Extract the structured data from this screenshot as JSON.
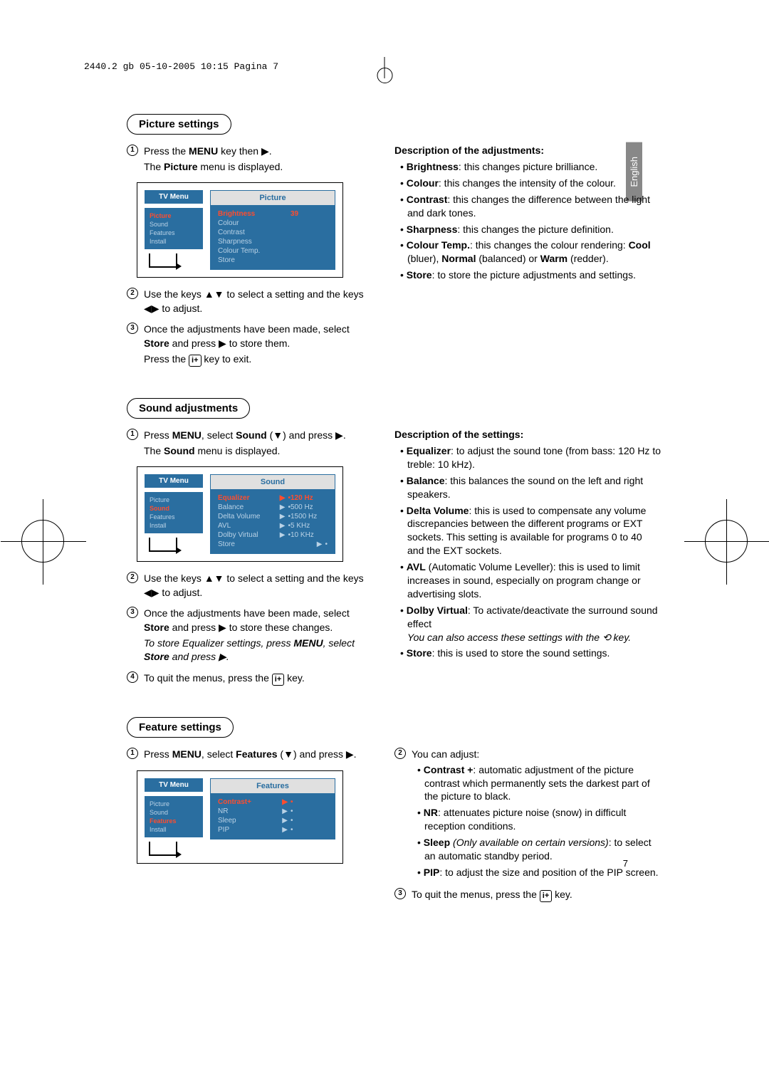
{
  "header": "2440.2 gb  05-10-2005  10:15  Pagina 7",
  "lang_tab": "English",
  "page_number": "7",
  "picture_section": {
    "heading": "Picture settings",
    "step1_a": "Press the ",
    "step1_menu": "MENU",
    "step1_b": " key then ▶.",
    "step1_c": "The ",
    "step1_picture": "Picture",
    "step1_d": " menu is displayed.",
    "menu": {
      "tv_menu": "TV Menu",
      "items": [
        "Picture",
        "Sound",
        "Features",
        "Install"
      ],
      "title": "Picture",
      "rows": [
        {
          "label": "Brightness",
          "value": "39",
          "sel": true
        },
        {
          "label": "Colour",
          "value": "",
          "dim": true
        },
        {
          "label": "Contrast",
          "value": "",
          "dim": true
        },
        {
          "label": "Sharpness",
          "value": "",
          "dim": true
        },
        {
          "label": "Colour Temp.",
          "value": "",
          "dim": true
        },
        {
          "label": "Store",
          "value": "",
          "dim": true
        }
      ]
    },
    "step2": "Use the keys ▲▼ to select a setting and the keys ◀▶ to adjust.",
    "step3_a": "Once the adjustments have been made, select ",
    "step3_store": "Store",
    "step3_b": " and press ▶ to store them.",
    "step3_c": "Press the ",
    "step3_key": "i+",
    "step3_d": " key to exit.",
    "desc_title": "Description of the adjustments:",
    "desc": {
      "brightness_k": "Brightness",
      "brightness_v": ": this changes picture brilliance.",
      "colour_k": "Colour",
      "colour_v": ": this changes the intensity of the colour.",
      "contrast_k": "Contrast",
      "contrast_v": ": this changes the difference between the light and dark tones.",
      "sharpness_k": "Sharpness",
      "sharpness_v": ": this changes the picture definition.",
      "ct_k": "Colour Temp.",
      "ct_v": ": this changes the colour rendering: ",
      "ct_cool": "Cool",
      "ct_cool_v": " (bluer), ",
      "ct_norm": "Normal",
      "ct_norm_v": " (balanced) or ",
      "ct_warm": "Warm",
      "ct_warm_v": " (redder).",
      "store_k": "Store",
      "store_v": ": to store the picture adjustments and settings."
    }
  },
  "sound_section": {
    "heading": "Sound adjustments",
    "step1_a": "Press ",
    "step1_menu": "MENU",
    "step1_b": ", select ",
    "step1_sound": "Sound",
    "step1_c": " (▼) and press ▶.",
    "step1_d": "The ",
    "step1_sound2": "Sound",
    "step1_e": " menu is displayed.",
    "menu": {
      "tv_menu": "TV Menu",
      "items": [
        "Picture",
        "Sound",
        "Features",
        "Install"
      ],
      "title": "Sound",
      "rows": [
        {
          "label": "Equalizer",
          "tri": "▶",
          "value": "120 Hz",
          "sel": true
        },
        {
          "label": "Balance",
          "tri": "▶",
          "value": "500 Hz",
          "dim": true
        },
        {
          "label": "Delta Volume",
          "tri": "▶",
          "value": "1500 Hz",
          "dim": true
        },
        {
          "label": "AVL",
          "tri": "▶",
          "value": "5 KHz",
          "dim": true
        },
        {
          "label": "Dolby Virtual",
          "tri": "▶",
          "value": "10 KHz",
          "dim": true
        },
        {
          "label": "Store",
          "tri": "▶",
          "value": "",
          "dim": true
        }
      ]
    },
    "step2": "Use the keys ▲▼ to select a setting and the keys ◀▶ to adjust.",
    "step3_a": "Once the adjustments have been made, select ",
    "step3_store": "Store",
    "step3_b": " and press ▶ to store these changes.",
    "step3_note_a": "To store Equalizer settings, press ",
    "step3_note_menu": "MENU",
    "step3_note_b": ", select ",
    "step3_note_store": "Store",
    "step3_note_c": " and press ▶.",
    "step4_a": "To quit the menus, press the ",
    "step4_key": "i+",
    "step4_b": " key.",
    "desc_title": "Description of the settings:",
    "desc": {
      "eq_k": "Equalizer",
      "eq_v": ": to adjust the sound tone (from bass: 120 Hz to treble: 10 kHz).",
      "bal_k": "Balance",
      "bal_v": ": this balances the sound on the left and right speakers.",
      "dv_k": "Delta Volume",
      "dv_v": ": this is used to compensate any volume discrepancies between the different programs or EXT sockets. This setting is available for programs 0 to 40 and the EXT sockets.",
      "avl_k": "AVL",
      "avl_v": " (Automatic Volume Leveller): this is used to limit increases in sound, especially on program change or advertising slots.",
      "dvirt_k": "Dolby Virtual",
      "dvirt_v": ": To activate/deactivate the surround sound effect",
      "dvirt_note_a": "You can also access these settings with the ",
      "dvirt_note_key": "⟲",
      "dvirt_note_b": " key.",
      "store_k": "Store",
      "store_v": ": this is used to store the sound settings."
    }
  },
  "feature_section": {
    "heading": "Feature settings",
    "step1_a": "Press ",
    "step1_menu": "MENU",
    "step1_b": ", select ",
    "step1_feat": "Features",
    "step1_c": " (▼) and press ▶.",
    "menu": {
      "tv_menu": "TV Menu",
      "items": [
        "Picture",
        "Sound",
        "Features",
        "Install"
      ],
      "title": "Features",
      "rows": [
        {
          "label": "Contrast+",
          "tri": "▶",
          "value": "•",
          "sel": true
        },
        {
          "label": "NR",
          "tri": "▶",
          "value": "•",
          "dim": true
        },
        {
          "label": "Sleep",
          "tri": "▶",
          "value": "•",
          "dim": true
        },
        {
          "label": "PIP",
          "tri": "▶",
          "value": "•",
          "dim": true
        }
      ]
    },
    "step2_intro": "You can adjust:",
    "desc": {
      "cp_k": "Contrast +",
      "cp_v": ": automatic adjustment of the picture contrast which permanently sets the darkest part of the picture to black.",
      "nr_k": "NR",
      "nr_v": ": attenuates picture noise (snow) in difficult reception conditions.",
      "sleep_k": "Sleep",
      "sleep_note": " (Only available on certain versions)",
      "sleep_v": ": to select an automatic standby period.",
      "pip_k": "PIP",
      "pip_v": ": to adjust the size and position of the PIP screen."
    },
    "step3_a": "To quit the menus, press the ",
    "step3_key": "i+",
    "step3_b": " key."
  }
}
